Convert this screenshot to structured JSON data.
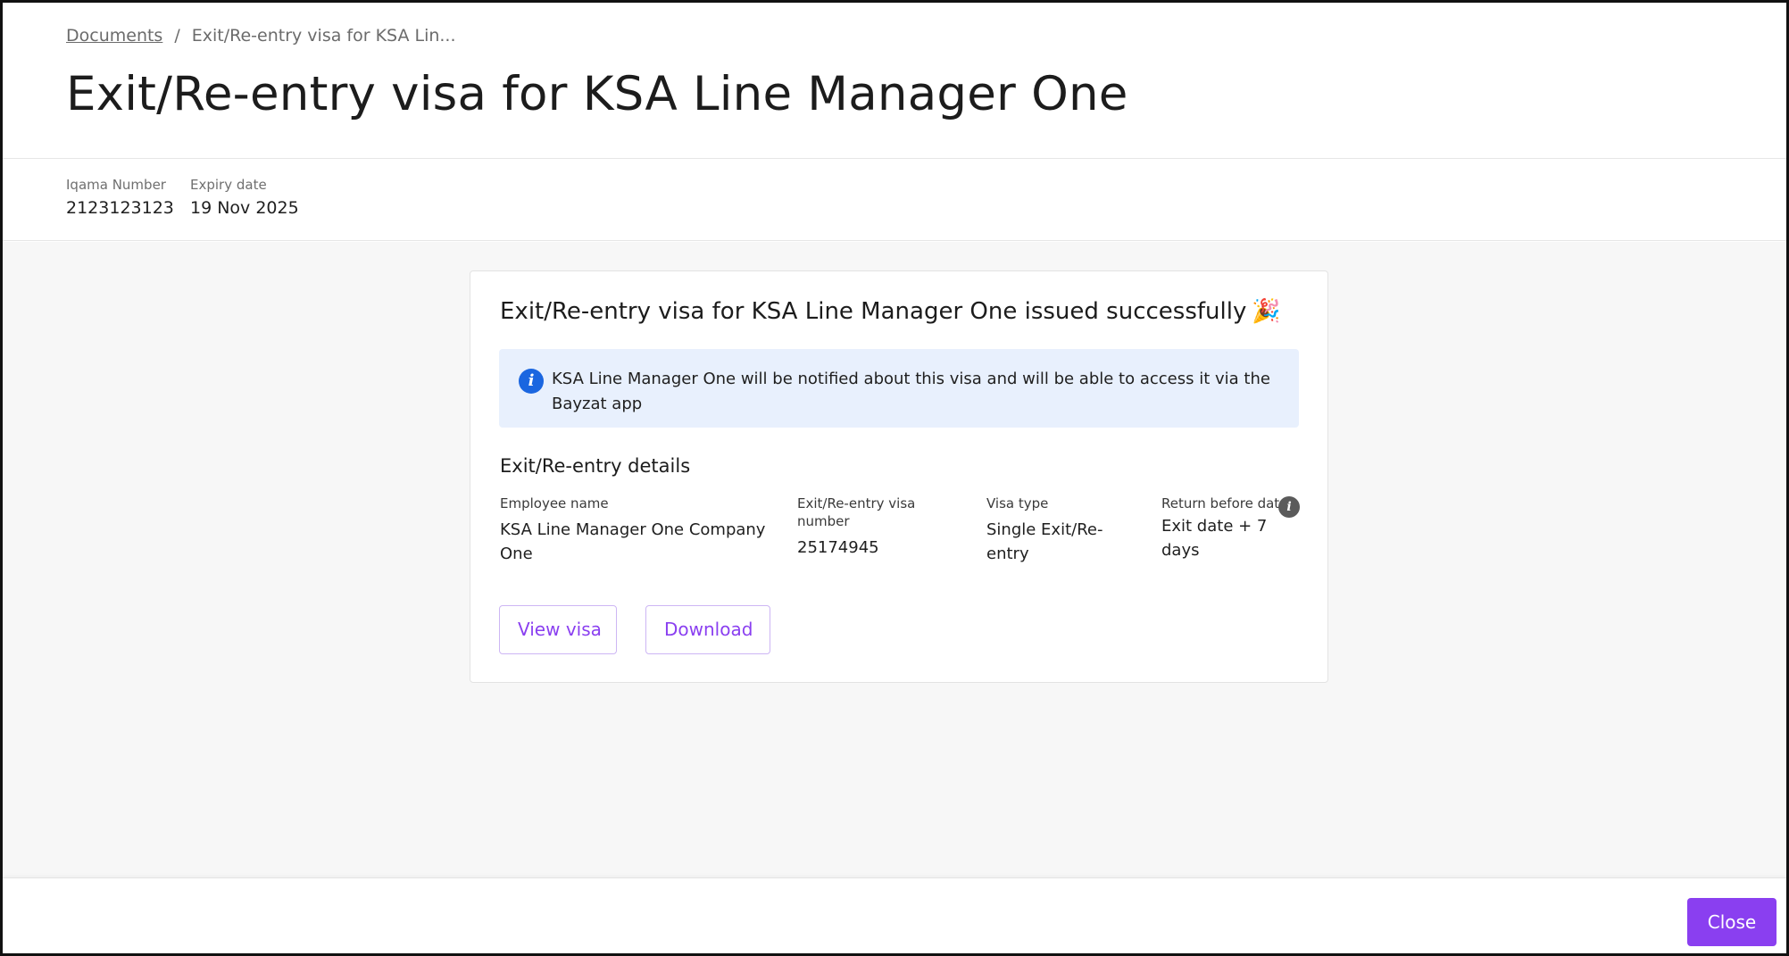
{
  "header": {
    "breadcrumb": {
      "root": "Documents",
      "separator": "/",
      "current": "Exit/Re-entry visa for KSA Lin..."
    },
    "title": "Exit/Re-entry visa for KSA Line Manager One"
  },
  "meta": {
    "iqama_label": "Iqama Number",
    "iqama_value": "2123123123",
    "expiry_label": "Expiry date",
    "expiry_value": "19 Nov 2025"
  },
  "card": {
    "title": "Exit/Re-entry visa for KSA Line Manager One issued successfully",
    "title_icon": "party-popper-icon",
    "title_emoji": "🎉",
    "info_banner": {
      "icon": "info-icon",
      "text": "KSA Line Manager One will be notified about this visa and will be able to access it via the Bayzat app"
    },
    "details": {
      "section_title": "Exit/Re-entry details",
      "employee_label": "Employee name",
      "employee_value": "KSA Line Manager One Company One",
      "visa_number_label": "Exit/Re-entry visa number",
      "visa_number_value": "25174945",
      "visa_type_label": "Visa type",
      "visa_type_value": "Single Exit/Re-entry",
      "return_label": "Return before date",
      "return_value": "Exit date + 7 days",
      "return_icon": "info-icon"
    },
    "buttons": {
      "view": "View visa",
      "download": "Download"
    }
  },
  "footer": {
    "close": "Close"
  },
  "colors": {
    "accent": "#8a3ff0",
    "info_bg": "#e8f0fd",
    "info_icon": "#1a66e0",
    "body_bg": "#f7f7f7"
  }
}
